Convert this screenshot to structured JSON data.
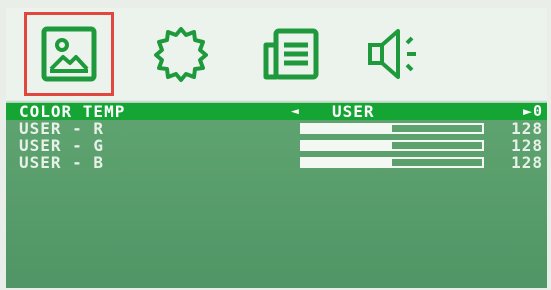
{
  "colors": {
    "accent": "#13a535",
    "icon": "#1e9a3c",
    "selection_border": "#e2473f",
    "panel": "#4f9565"
  },
  "icon_tabs": [
    {
      "icon": "picture-icon",
      "selected": true
    },
    {
      "icon": "gear-icon",
      "selected": false
    },
    {
      "icon": "document-icon",
      "selected": false
    },
    {
      "icon": "speaker-icon",
      "selected": false
    }
  ],
  "menu": {
    "color_temp": {
      "label": "COLOR TEMP",
      "arrow_left": "◄",
      "value": "USER",
      "arrow_right": "►0"
    },
    "items": [
      {
        "label": "USER - R",
        "value": "128",
        "level": 0.5
      },
      {
        "label": "USER - G",
        "value": "128",
        "level": 0.5
      },
      {
        "label": "USER - B",
        "value": "128",
        "level": 0.5
      }
    ]
  }
}
